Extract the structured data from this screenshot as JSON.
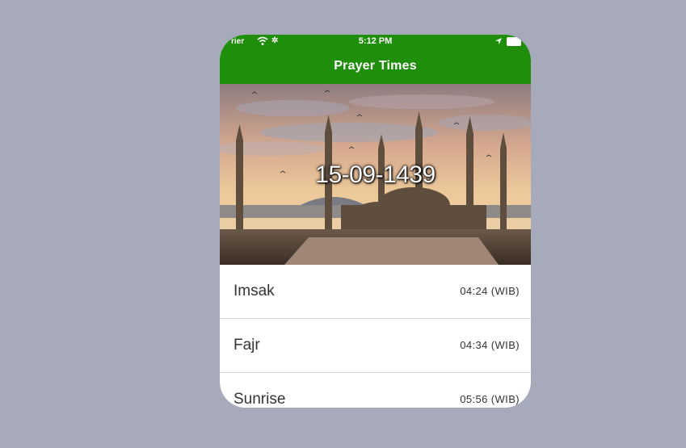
{
  "status_bar": {
    "carrier": "rier",
    "time": "5:12 PM"
  },
  "header": {
    "title": "Prayer Times"
  },
  "hero": {
    "hijri_date": "15-09-1439"
  },
  "prayers": [
    {
      "name": "Imsak",
      "time": "04:24 (WIB)"
    },
    {
      "name": "Fajr",
      "time": "04:34 (WIB)"
    },
    {
      "name": "Sunrise",
      "time": "05:56 (WIB)"
    }
  ],
  "colors": {
    "header_green": "#1f8e0b",
    "page_background": "#a6aabb"
  }
}
